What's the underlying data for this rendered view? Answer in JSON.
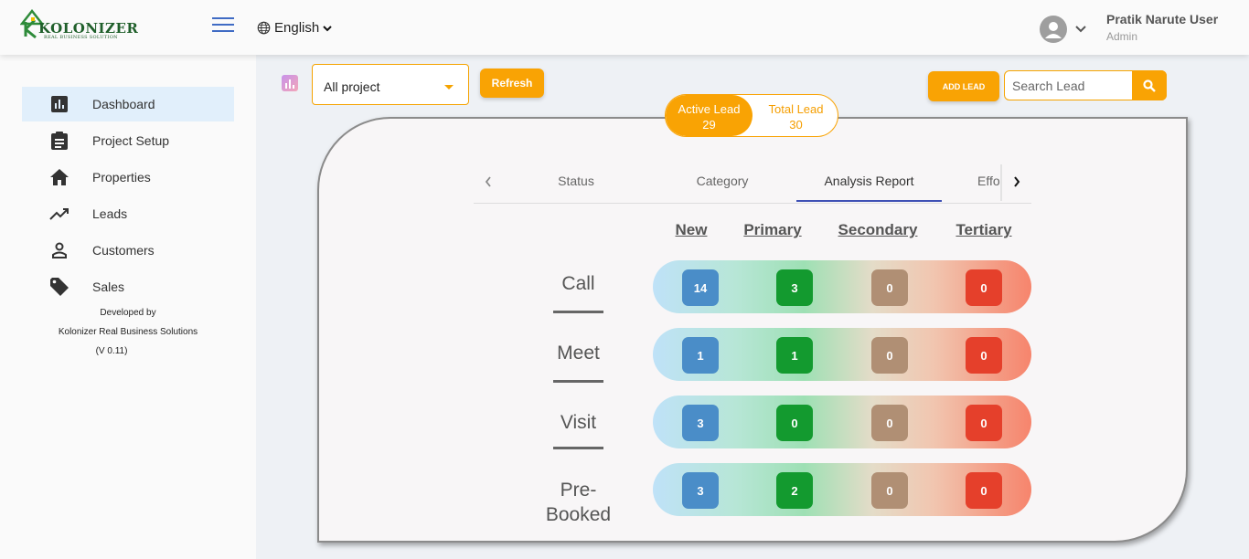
{
  "header": {
    "logo_text": "KOLONIZER",
    "logo_sub": "REAL BUSINESS SOLUTION",
    "language": "English",
    "user_name": "Pratik Narute User",
    "user_role": "Admin"
  },
  "sidebar": {
    "items": [
      {
        "label": "Dashboard",
        "icon": "bar-chart-icon",
        "active": true
      },
      {
        "label": "Project Setup",
        "icon": "clipboard-icon"
      },
      {
        "label": "Properties",
        "icon": "home-icon"
      },
      {
        "label": "Leads",
        "icon": "trending-up-icon"
      },
      {
        "label": "Customers",
        "icon": "person-icon"
      },
      {
        "label": "Sales",
        "icon": "tag-icon"
      }
    ],
    "footer": {
      "line1": "Developed by",
      "line2": "Kolonizer Real Business Solutions",
      "line3": "(V 0.11)"
    }
  },
  "toolbar": {
    "project_select": "All project",
    "refresh_label": "Refresh",
    "add_lead_label": "ADD LEAD",
    "search_placeholder": "Search Lead"
  },
  "lead_toggle": {
    "active": {
      "label": "Active Lead",
      "count": "29"
    },
    "total": {
      "label": "Total Lead",
      "count": "30"
    }
  },
  "tabs": [
    "Status",
    "Category",
    "Analysis Report",
    "Effo"
  ],
  "active_tab": "Analysis Report",
  "columns": [
    "New",
    "Primary",
    "Secondary",
    "Tertiary"
  ],
  "rows": [
    {
      "label": "Call",
      "values": [
        "14",
        "3",
        "0",
        "0"
      ]
    },
    {
      "label": "Meet",
      "values": [
        "1",
        "1",
        "0",
        "0"
      ]
    },
    {
      "label": "Visit",
      "values": [
        "3",
        "0",
        "0",
        "0"
      ]
    },
    {
      "label": "Pre-\nBooked",
      "values": [
        "3",
        "2",
        "0",
        "0"
      ]
    }
  ],
  "colors": {
    "accent": "#f9a304",
    "new": "#4a8dc8",
    "primary": "#139a2f",
    "secondary": "#b08f74",
    "tertiary": "#e5402b"
  }
}
